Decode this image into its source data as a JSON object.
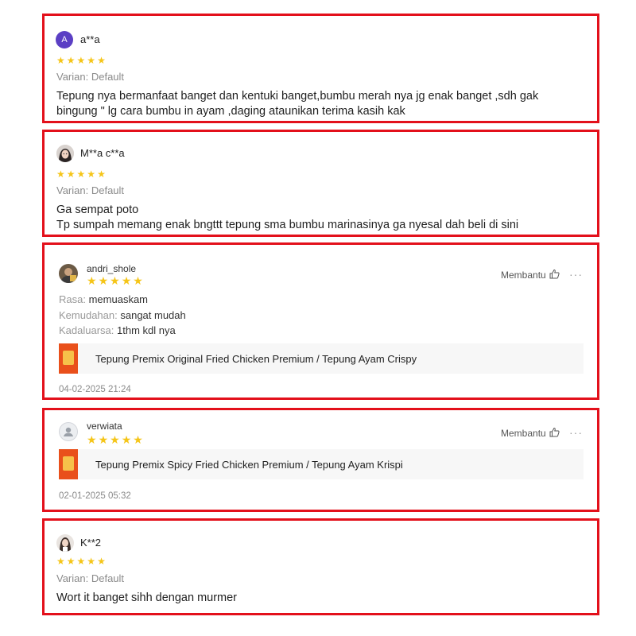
{
  "reviews": [
    {
      "user": "a**a",
      "avatar_letter": "A",
      "rating": 5,
      "variant": "Varian: Default",
      "lines": [
        "Tepung nya bermanfaat banget dan kentuki banget,bumbu merah nya jg enak banget ,sdh gak",
        "bingung \" lg cara bumbu in ayam ,daging ataunikan terima kasih kak"
      ]
    },
    {
      "user": "M**a c**a",
      "rating": 5,
      "variant": "Varian: Default",
      "lines": [
        "Ga sempat poto",
        "Tp sumpah memang enak bngttt tepung sma bumbu marinasinya ga nyesal dah beli di sini"
      ]
    },
    {
      "user": "andri_shole",
      "rating": 5,
      "helpful_label": "Membantu",
      "more": "···",
      "attributes": [
        {
          "key": "Rasa:",
          "value": "memuaskam"
        },
        {
          "key": "Kemudahan:",
          "value": "sangat mudah"
        },
        {
          "key": "Kadaluarsa:",
          "value": "1thm kdl nya"
        }
      ],
      "product": "Tepung Premix Original Fried Chicken Premium / Tepung Ayam Crispy",
      "date": "04-02-2025 21:24"
    },
    {
      "user": "verwiata",
      "rating": 5,
      "helpful_label": "Membantu",
      "more": "···",
      "product": "Tepung Premix Spicy Fried Chicken Premium / Tepung Ayam Krispi",
      "date": "02-01-2025 05:32"
    },
    {
      "user": "K**2",
      "rating": 5,
      "variant": "Varian: Default",
      "lines": [
        "Wort it banget sihh dengan murmer"
      ]
    }
  ],
  "colors": {
    "highlight_border": "#e3101b",
    "star": "#f5c518",
    "avatar_a": "#5b3fc4"
  },
  "icons": {
    "star": "star-icon",
    "thumbs_up": "thumbs-up-icon",
    "more": "more-options-icon",
    "avatar_placeholder": "user-placeholder-icon"
  }
}
